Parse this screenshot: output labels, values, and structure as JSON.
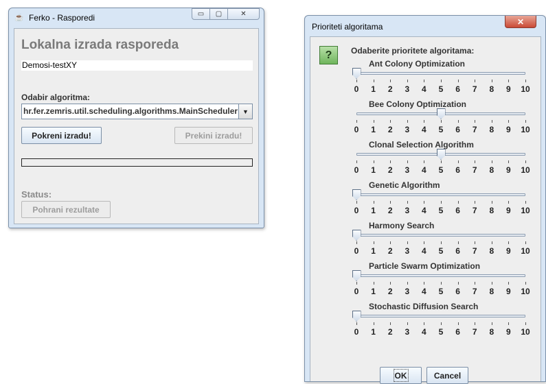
{
  "main_window": {
    "title": "Ferko - Rasporedi",
    "heading": "Lokalna izrada rasporeda",
    "schedule_name": "Demosi-testXY",
    "algorithm_label": "Odabir algoritma:",
    "algorithm_selected": "hr.fer.zemris.util.scheduling.algorithms.MainScheduler",
    "start_button": "Pokreni izradu!",
    "stop_button": "Prekini izradu!",
    "progress_value": 0,
    "status_label": "Status:",
    "save_button": "Pohrani rezultate",
    "title_buttons": {
      "minimize": "▭",
      "maximize": "▢",
      "close": "✕"
    },
    "icons": {
      "app": "java-icon",
      "dropdown": "chevron-down-icon"
    }
  },
  "priority_dialog": {
    "title": "Prioriteti algoritama",
    "close_glyph": "✕",
    "icon": "question-icon",
    "icon_glyph": "?",
    "message": "Odaberite prioritete algoritama:",
    "scale_min": 0,
    "scale_max": 10,
    "ticks": [
      "0",
      "1",
      "2",
      "3",
      "4",
      "5",
      "6",
      "7",
      "8",
      "9",
      "10"
    ],
    "algorithms": [
      {
        "name": "Ant Colony Optimization",
        "value": 0
      },
      {
        "name": "Bee Colony Optimization",
        "value": 5
      },
      {
        "name": "Clonal Selection Algorithm",
        "value": 5
      },
      {
        "name": "Genetic Algorithm",
        "value": 0
      },
      {
        "name": "Harmony Search",
        "value": 0
      },
      {
        "name": "Particle Swarm Optimization",
        "value": 0
      },
      {
        "name": "Stochastic Diffusion Search",
        "value": 0
      }
    ],
    "ok_button": "OK",
    "cancel_button": "Cancel"
  }
}
